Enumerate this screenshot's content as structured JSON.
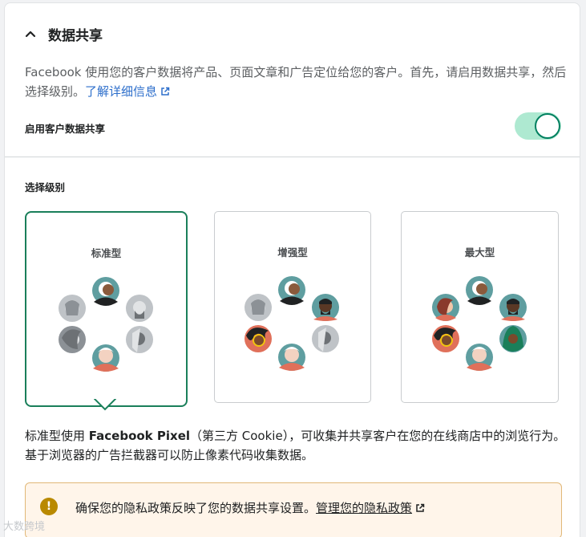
{
  "section": {
    "title": "数据共享"
  },
  "description": {
    "text": "Facebook 使用您的客户数据将产品、页面文章和广告定位给您的客户。首先，请启用数据共享，然后选择级别。",
    "link": "了解详细信息"
  },
  "toggle": {
    "label": "启用客户数据共享",
    "enabled": true
  },
  "level": {
    "title": "选择级别",
    "options": [
      {
        "label": "标准型",
        "selected": true
      },
      {
        "label": "增强型",
        "selected": false
      },
      {
        "label": "最大型",
        "selected": false
      }
    ]
  },
  "explain": {
    "prefix": "标准型使用 ",
    "bold": "Facebook Pixel",
    "suffix": "（第三方 Cookie），可收集并共享客户在您的在线商店中的浏览行为。基于浏览器的广告拦截器可以防止像素代码收集数据。"
  },
  "warning": {
    "icon": "!",
    "text": "确保您的隐私政策反映了您的数据共享设置。",
    "link": "管理您的隐私政策"
  },
  "watermark": "大数跨境",
  "colors": {
    "accent": "#008060",
    "toggle_bg": "#aee9d1",
    "link": "#2c6ecb",
    "warning_bg": "#fff5ea"
  }
}
